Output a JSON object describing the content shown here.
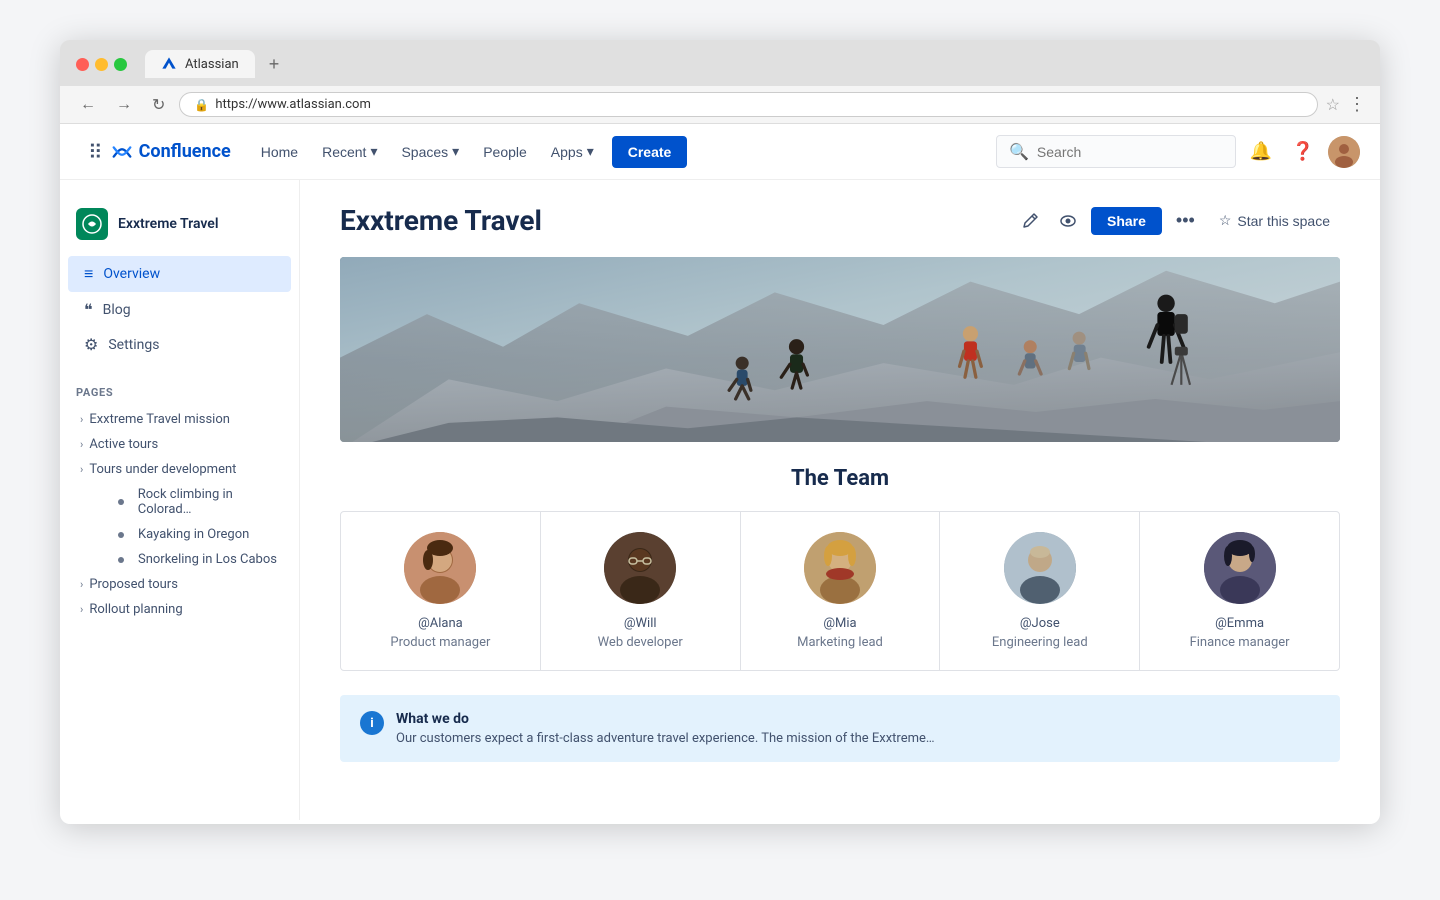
{
  "browser": {
    "tab_title": "Atlassian",
    "url": "https://www.atlassian.com",
    "tab_plus": "+"
  },
  "topnav": {
    "logo_text": "Confluence",
    "home_label": "Home",
    "recent_label": "Recent",
    "spaces_label": "Spaces",
    "people_label": "People",
    "apps_label": "Apps",
    "create_label": "Create",
    "search_placeholder": "Search"
  },
  "sidebar": {
    "space_name": "Exxtreme Travel",
    "nav": {
      "overview": "Overview",
      "blog": "Blog",
      "settings": "Settings"
    },
    "pages_label": "PAGES",
    "pages": [
      {
        "label": "Exxtreme Travel mission",
        "indent": 0
      },
      {
        "label": "Active tours",
        "indent": 0
      },
      {
        "label": "Tours under development",
        "indent": 0
      },
      {
        "label": "Rock climbing in Colorad…",
        "indent": 1
      },
      {
        "label": "Kayaking in Oregon",
        "indent": 1
      },
      {
        "label": "Snorkeling in Los Cabos",
        "indent": 1
      },
      {
        "label": "Proposed tours",
        "indent": 0
      },
      {
        "label": "Rollout planning",
        "indent": 0
      }
    ]
  },
  "content": {
    "page_title": "Exxtreme Travel",
    "share_label": "Share",
    "star_space_label": "Star this space",
    "more_label": "···",
    "team_section_title": "The Team",
    "team_members": [
      {
        "handle": "@Alana",
        "role": "Product manager"
      },
      {
        "handle": "@Will",
        "role": "Web developer"
      },
      {
        "handle": "@Mia",
        "role": "Marketing lead"
      },
      {
        "handle": "@Jose",
        "role": "Engineering lead"
      },
      {
        "handle": "@Emma",
        "role": "Finance manager"
      }
    ],
    "info_box": {
      "title": "What we do",
      "text": "Our customers expect a first-class adventure travel experience. The mission of the Exxtreme…"
    }
  }
}
